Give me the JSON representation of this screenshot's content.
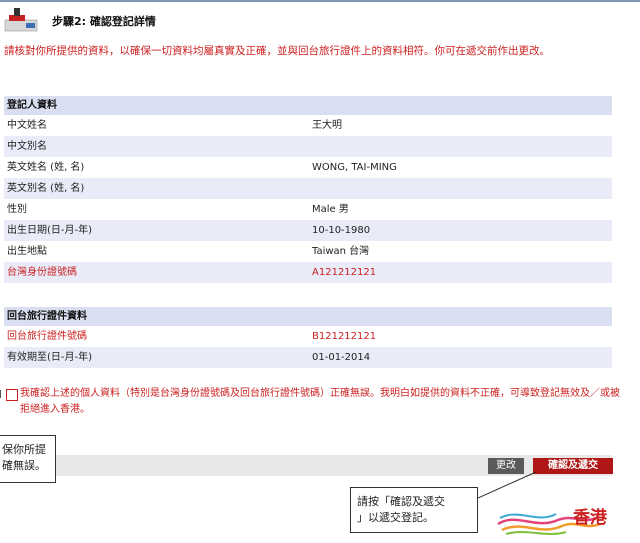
{
  "step": {
    "title": "步驟2: 確認登記詳情"
  },
  "instruction": "請核對你所提供的資料，以確保一切資料均屬真實及正確，並與回台旅行證件上的資料相符。你可在遞交前作出更改。",
  "registrant": {
    "heading": "登記人資料",
    "rows": [
      {
        "label": "中文姓名",
        "value": "王大明"
      },
      {
        "label": "中文別名",
        "value": ""
      },
      {
        "label": "英文姓名 (姓, 名)",
        "value": "WONG, TAI-MING"
      },
      {
        "label": "英文別名 (姓, 名)",
        "value": ""
      },
      {
        "label": "性別",
        "value": "Male 男"
      },
      {
        "label": "出生日期(日-月-年)",
        "value": "10-10-1980"
      },
      {
        "label": "出生地點",
        "value": "Taiwan 台灣"
      },
      {
        "label": "台灣身份證號碼",
        "value": "A121212121"
      }
    ]
  },
  "travel_doc": {
    "heading": "回台旅行證件資料",
    "rows": [
      {
        "label": "回台旅行證件號碼",
        "value": "B121212121"
      },
      {
        "label": "有效期至(日-月-年)",
        "value": "01-01-2014"
      }
    ]
  },
  "declaration": "我確認上述的個人資料（特別是台灣身份證號碼及回台旅行證件號碼）正確無誤。我明白如提供的資料不正確，可導致登記無效及／或被拒絕進入香港。",
  "callout_left": {
    "line1": "保你所提",
    "line2": "確無誤。"
  },
  "buttons": {
    "modify": "更改",
    "confirm": "確認及遞交"
  },
  "callout_right": {
    "line1": "請按「確認及遞交",
    "line2": "」以遞交登記。"
  },
  "brand": {
    "text": "香港"
  },
  "colors": {
    "accent_red": "#cc1f1f",
    "header_blue": "#d9dff1",
    "row_blue": "#e9ecf8"
  }
}
